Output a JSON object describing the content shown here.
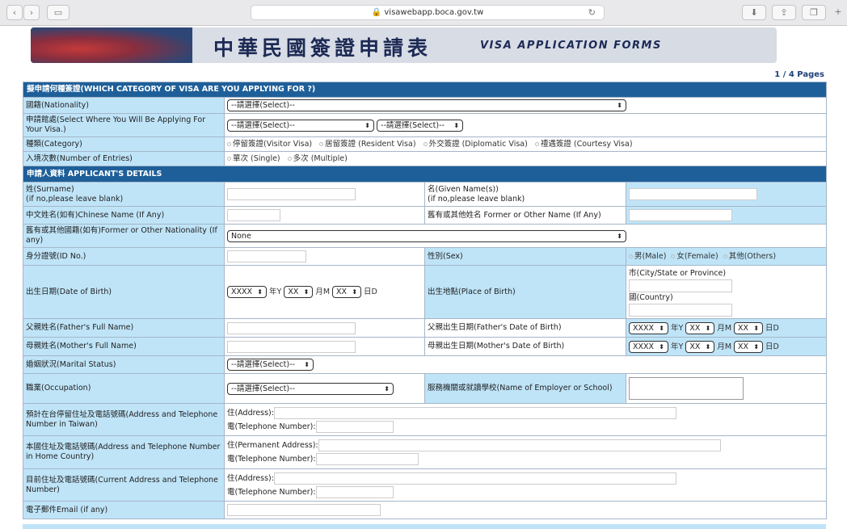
{
  "browser": {
    "url": "visawebapp.boca.gov.tw"
  },
  "banner": {
    "zh": "中華民國簽證申請表",
    "en": "VISA  APPLICATION  FORMS"
  },
  "pages": "1 / 4 Pages",
  "sec1": "擬申請何種簽證(WHICH CATEGORY OF VISA ARE YOU APPLYING FOR ?)",
  "sec2": "申請人資料 APPLICANT'S DETAILS",
  "labels": {
    "nationality": "國籍(Nationality)",
    "where": "申請館處(Select Where You Will Be Applying For Your Visa.)",
    "category": "種類(Category)",
    "entries": "入境次數(Number of Entries)",
    "surname1": "姓(Surname)",
    "surname2": "(if no,please leave blank)",
    "given1": "名(Given Name(s))",
    "given2": "(if no,please leave blank)",
    "chinese": "中文姓名(如有)Chinese Name (If Any)",
    "former": "舊有或其他姓名 Former or Other Name (If Any)",
    "formernat": "舊有或其他國籍(如有)Former or Other Nationality (If any)",
    "idno": "身分證號(ID No.)",
    "sex": "性別(Sex)",
    "dob": "出生日期(Date of Birth)",
    "pob": "出生地點(Place of Birth)",
    "city": "市(City/State or Province)",
    "country": "國(Country)",
    "father": "父親姓名(Father's Full Name)",
    "fatherdob": "父親出生日期(Father's Date of Birth)",
    "mother": "母親姓名(Mother's Full Name)",
    "motherdob": "母親出生日期(Mother's Date of Birth)",
    "marital": "婚姻狀況(Marital Status)",
    "occupation": "職業(Occupation)",
    "employer": "服務機關或就讀學校(Name of Employer or School)",
    "taiwanaddr": "預計在台停留住址及電話號碼(Address and Telephone Number in Taiwan)",
    "homeaddr": "本國住址及電話號碼(Address and Telephone Number in Home Country)",
    "curaddr": "目前住址及電話號碼(Current Address and Telephone Number)",
    "email": "電子郵件Email (if any)",
    "address": "住(Address):",
    "permaddr": "住(Permanent Address):",
    "tel": "電(Telephone Number):"
  },
  "selects": {
    "select": "--請選擇(Select)--",
    "none": "None",
    "year": "XXXX",
    "md": "XX"
  },
  "units": {
    "y": "年Y",
    "m": "月M",
    "d": "日D"
  },
  "category_opts": [
    "停留簽證(Visitor Visa)",
    "居留簽證 (Resident Visa)",
    "外交簽證 (Diplomatic Visa)",
    "禮遇簽證 (Courtesy Visa)"
  ],
  "entries_opts": [
    "單次 (Single)",
    "多次 (Multiple)"
  ],
  "sex_opts": [
    "男(Male)",
    "女(Female)",
    "其他(Others)"
  ],
  "colors": {
    "section": "#1e5f99",
    "label": "#bfe4f8"
  }
}
